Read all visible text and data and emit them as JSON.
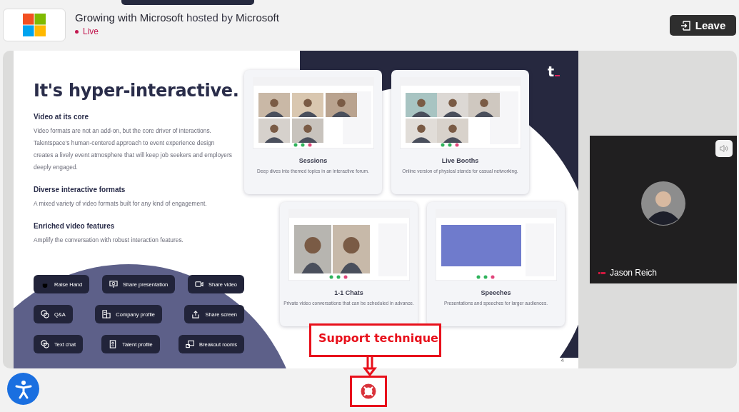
{
  "event": {
    "title": "**Growing with Microsoft** hosted by **Microsoft**",
    "status": "Live"
  },
  "leave_button": {
    "label": "Leave"
  },
  "slide": {
    "heading": "It's hyper-interactive.",
    "sections": [
      {
        "title": "Video at its core",
        "text": "Video formats are not an add-on, but the core driver of interactions. Talentspace's human-centered approach to event experience design creates a lively event atmosphere that will keep job seekers and employers deeply engaged."
      },
      {
        "title": "Diverse interactive formats",
        "text": "A mixed variety of video formats built for any kind of engagement."
      },
      {
        "title": "Enriched video features",
        "text": "Amplify the conversation with robust interaction features."
      }
    ],
    "features": [
      [
        "Raise Hand",
        "Share presentation",
        "Share video"
      ],
      [
        "Q&A",
        "Company profile",
        "Share screen"
      ],
      [
        "Text chat",
        "Talent profile",
        "Breakout rooms"
      ]
    ],
    "formats": [
      {
        "title": "Sessions",
        "description": "Deep dives into themed topics in an interactive forum."
      },
      {
        "title": "Live Booths",
        "description": "Online version of physical stands for casual networking."
      },
      {
        "title": "1-1 Chats",
        "description": "Private video conversations that can be scheduled in advance."
      },
      {
        "title": "Speeches",
        "description": "Presentations and speeches for larger audiences."
      }
    ],
    "logo_text": "t",
    "page_number": "4"
  },
  "participant": {
    "name": "Jason Reich"
  },
  "support_callout": {
    "label": "Support technique"
  }
}
